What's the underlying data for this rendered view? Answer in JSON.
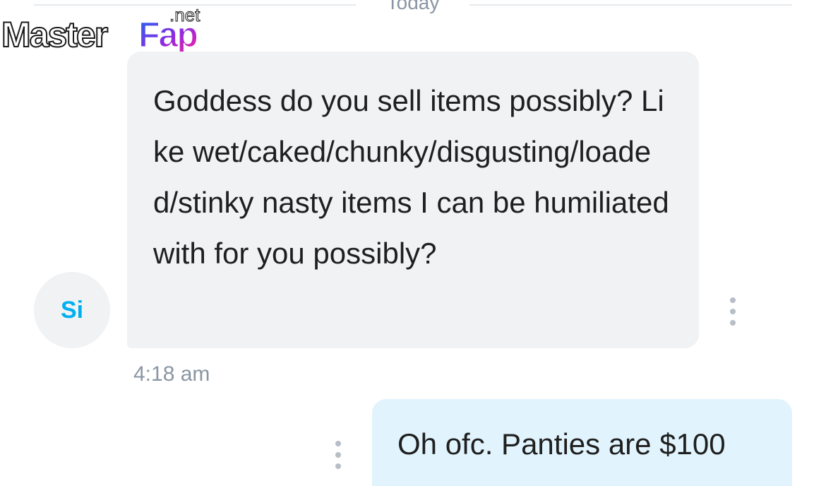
{
  "date_divider": {
    "label": "Today"
  },
  "watermark": {
    "text_main": "Master",
    "text_accent": "Fap",
    "text_suffix": ".net"
  },
  "incoming_message": {
    "avatar_initials": "Si",
    "text": "Goddess do you sell items possibly? Like wet/caked/chunky/disgusting/loaded/stinky nasty items I can be humiliated with for you possibly?",
    "time": "4:18 am"
  },
  "outgoing_message": {
    "text": "Oh ofc. Panties are $100"
  },
  "colors": {
    "accent": "#00aff0",
    "incoming_bubble": "#f0f2f4",
    "outgoing_bubble": "#e1f3fc",
    "muted_text": "#8a96a3"
  }
}
